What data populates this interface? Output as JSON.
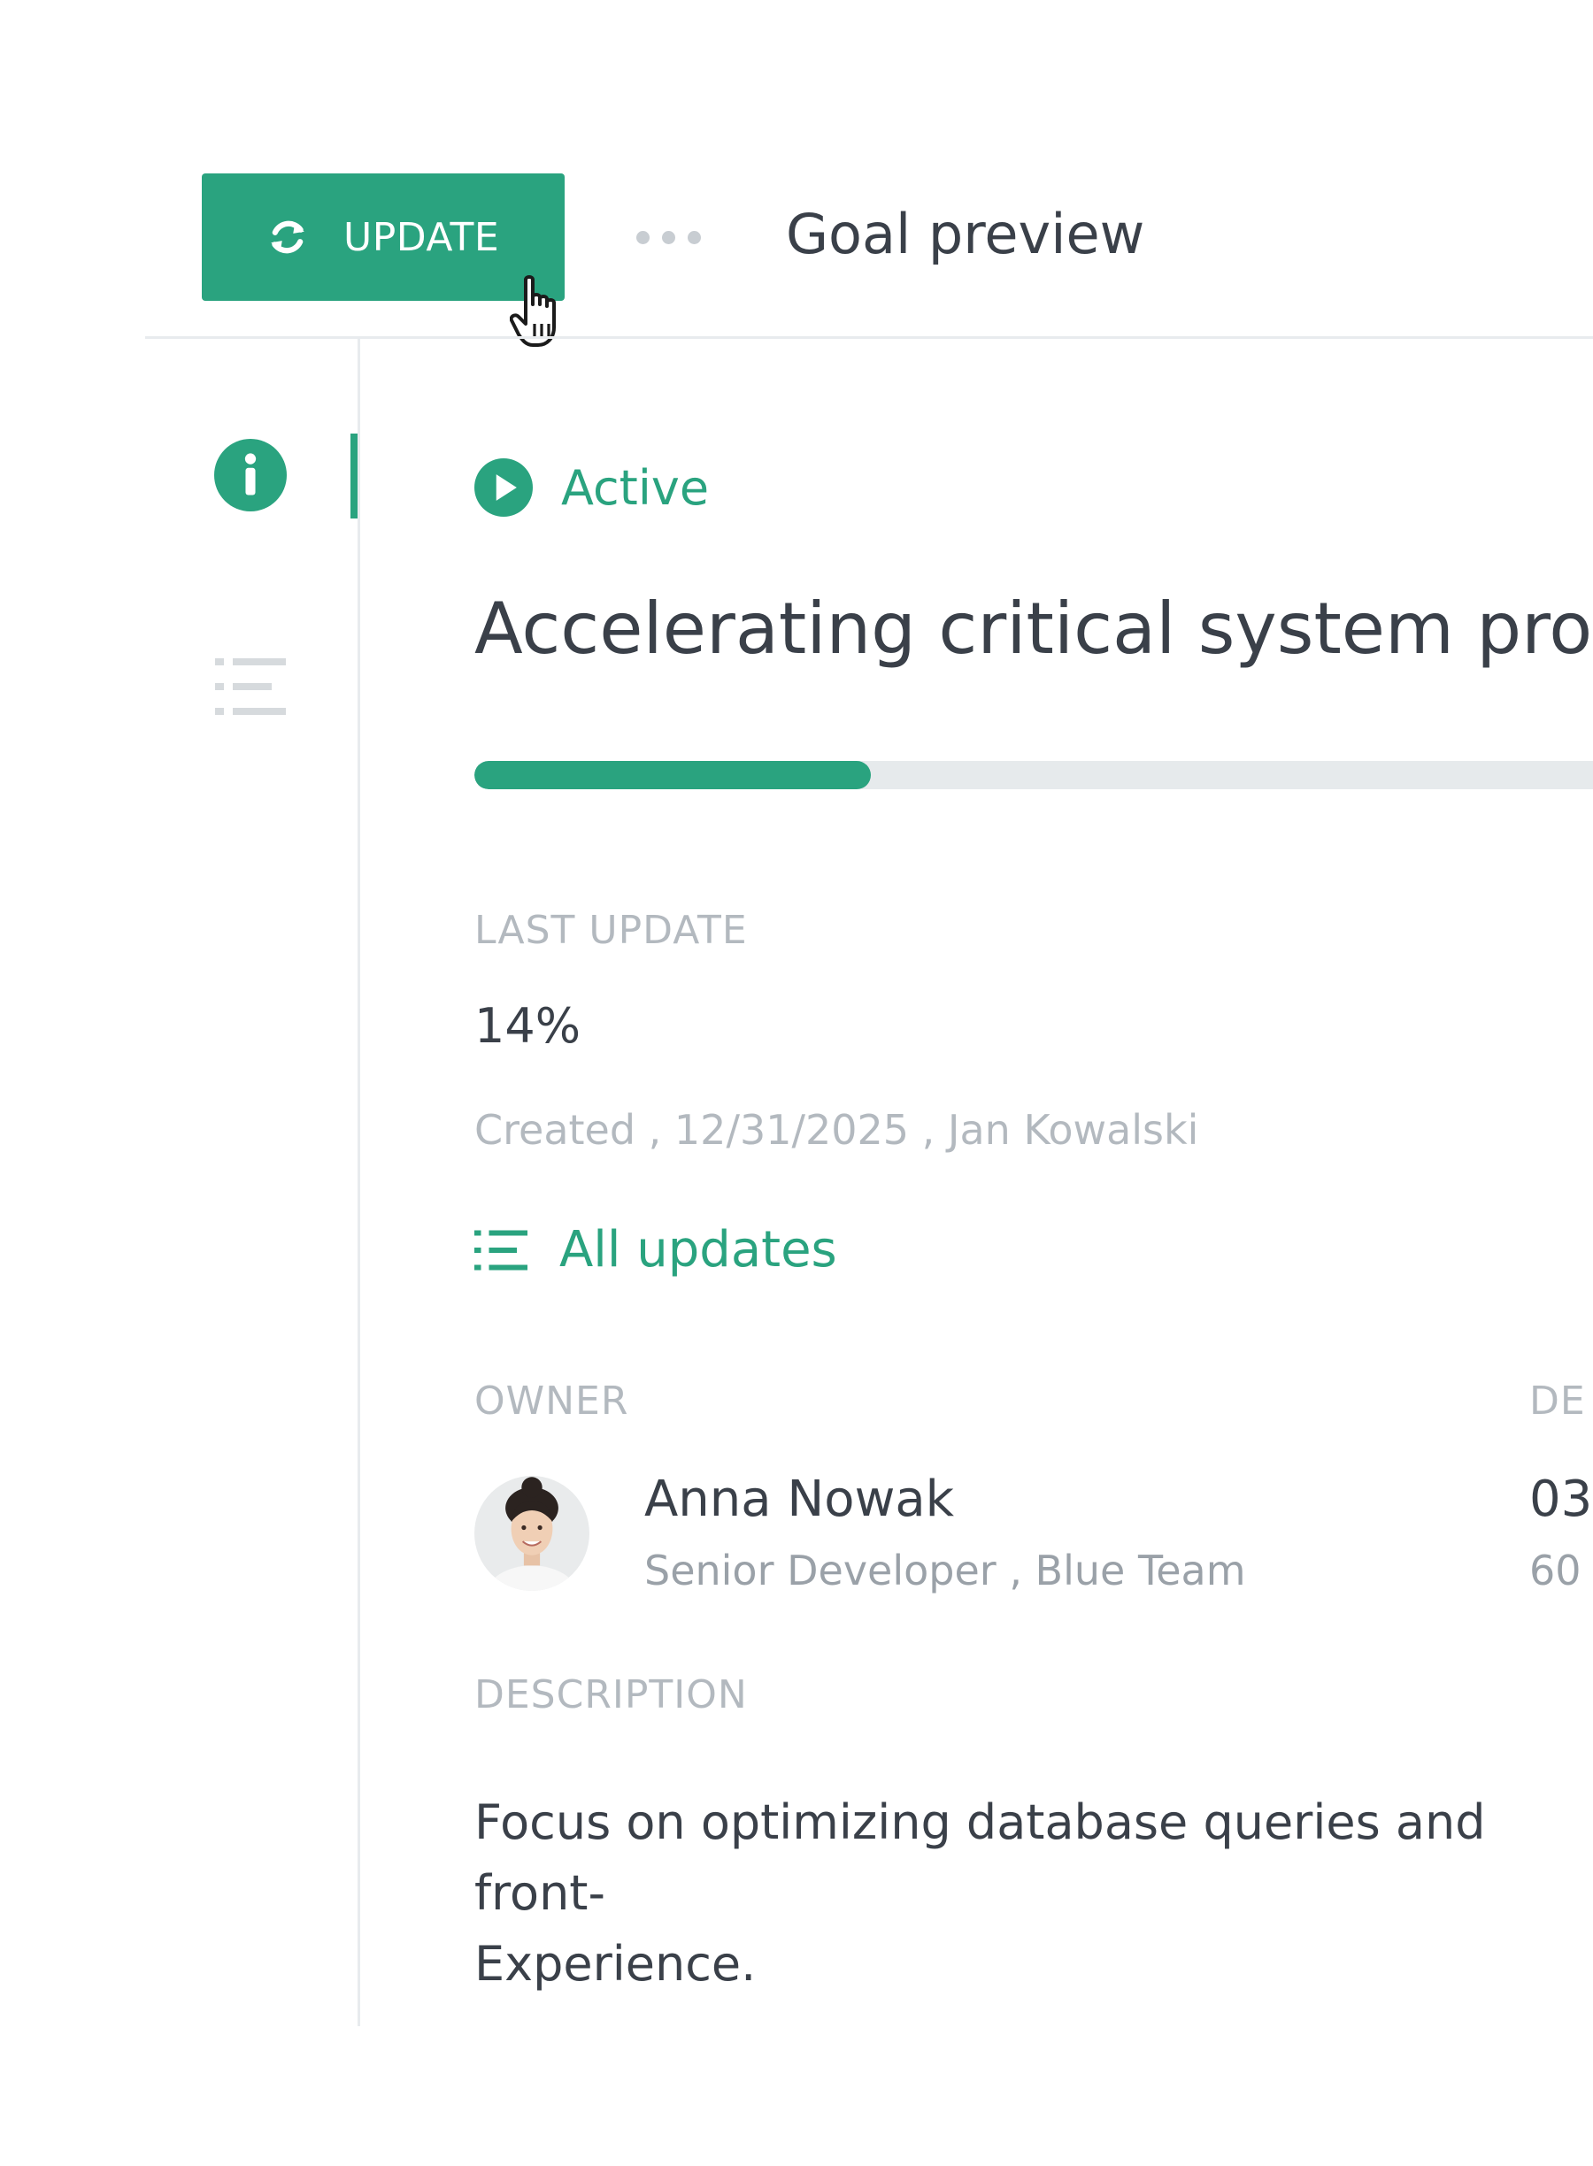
{
  "toolbar": {
    "update_label": "UPDATE",
    "title": "Goal preview",
    "more_icon": "more-horizontal-icon",
    "refresh_icon": "refresh-icon"
  },
  "sidebar": {
    "items": [
      {
        "icon": "info-icon",
        "active": true
      },
      {
        "icon": "list-icon",
        "active": false
      }
    ]
  },
  "goal": {
    "status": "Active",
    "title": "Accelerating critical system proce",
    "progress_percent": 14
  },
  "last_update": {
    "label": "LAST UPDATE",
    "value": "14%",
    "meta": "Created , 12/31/2025 , Jan Kowalski",
    "all_updates_label": "All updates"
  },
  "owner": {
    "label": "OWNER",
    "name": "Anna Nowak",
    "role": "Senior Developer , Blue Team"
  },
  "second_column": {
    "label": "DE",
    "value": "03",
    "sub": "60"
  },
  "description": {
    "label": "DESCRIPTION",
    "text": "Focus on optimizing database queries and front-\nExperience."
  },
  "colors": {
    "accent": "#2aa37f",
    "muted_label": "#b3b9bf",
    "text": "#3a4049"
  }
}
